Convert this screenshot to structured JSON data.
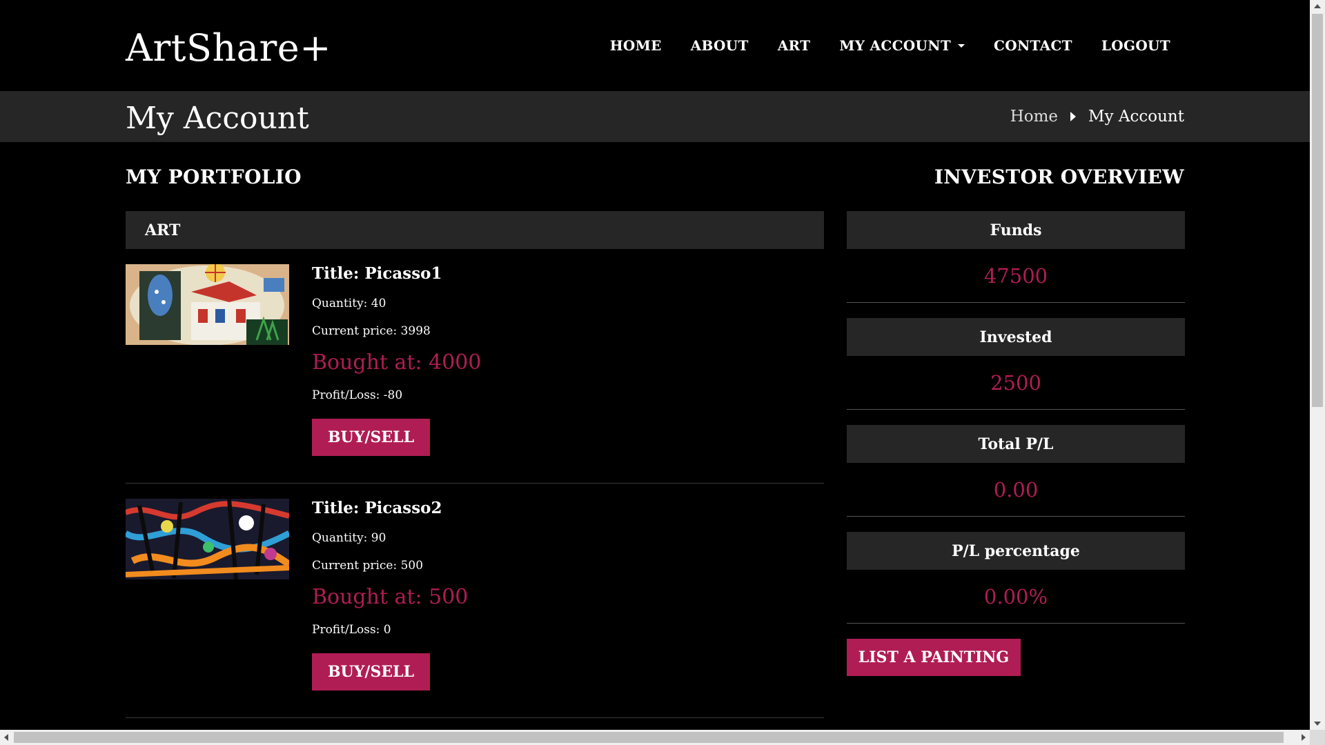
{
  "header": {
    "logo": "ArtShare+",
    "nav": [
      {
        "label": "HOME"
      },
      {
        "label": "ABOUT"
      },
      {
        "label": "ART"
      },
      {
        "label": "MY ACCOUNT",
        "dropdown": true
      },
      {
        "label": "CONTACT"
      },
      {
        "label": "LOGOUT"
      }
    ]
  },
  "title_bar": {
    "title": "My Account",
    "breadcrumb": {
      "home": "Home",
      "current": "My Account"
    }
  },
  "portfolio": {
    "heading": "MY PORTFOLIO",
    "table_header": "ART",
    "items": [
      {
        "title": "Title: Picasso1",
        "quantity": "Quantity: 40",
        "current_price": "Current price: 3998",
        "bought_at": "Bought at: 4000",
        "profit_loss": "Profit/Loss: -80",
        "button": "BUY/SELL"
      },
      {
        "title": "Title: Picasso2",
        "quantity": "Quantity: 90",
        "current_price": "Current price: 500",
        "bought_at": "Bought at: 500",
        "profit_loss": "Profit/Loss: 0",
        "button": "BUY/SELL"
      }
    ]
  },
  "overview": {
    "heading": "INVESTOR OVERVIEW",
    "stats": [
      {
        "label": "Funds",
        "value": "47500"
      },
      {
        "label": "Invested",
        "value": "2500"
      },
      {
        "label": "Total P/L",
        "value": "0.00"
      },
      {
        "label": "P/L percentage",
        "value": "0.00%"
      }
    ],
    "list_button": "LIST A PAINTING"
  },
  "colors": {
    "accent": "#b01d54",
    "panel": "#262626",
    "background": "#000000"
  }
}
